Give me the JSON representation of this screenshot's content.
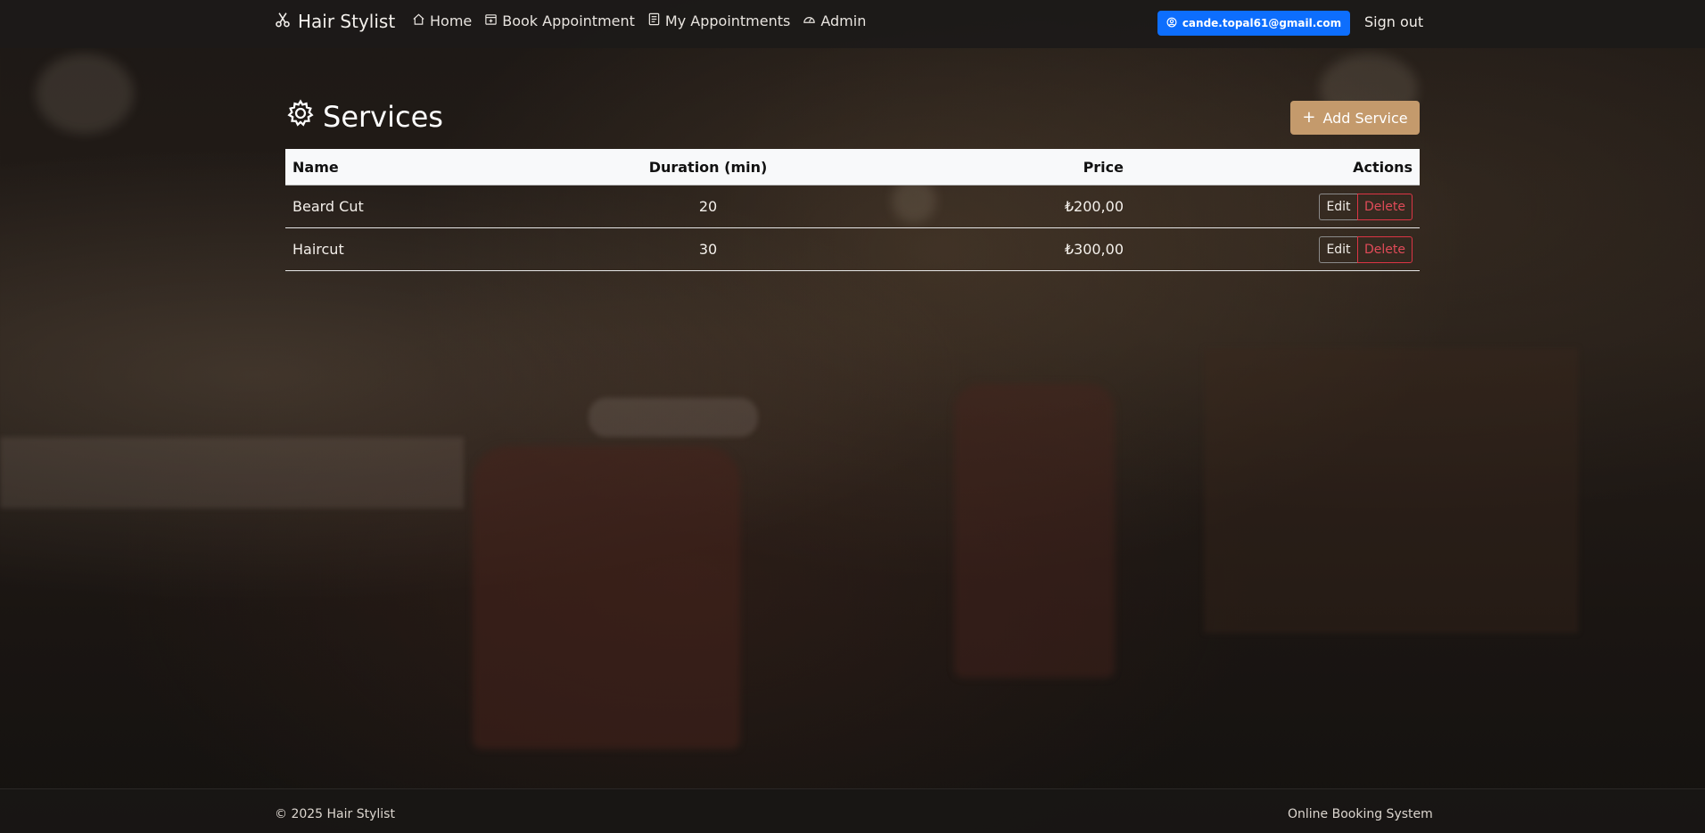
{
  "nav": {
    "brand": "Hair Stylist",
    "links": [
      {
        "label": "Home",
        "icon": "home-icon"
      },
      {
        "label": "Book Appointment",
        "icon": "calendar-plus-icon"
      },
      {
        "label": "My Appointments",
        "icon": "list-icon"
      },
      {
        "label": "Admin",
        "icon": "speedometer-icon"
      }
    ],
    "user_email": "cande.topal61@gmail.com",
    "signout": "Sign out"
  },
  "main": {
    "title": "Services",
    "add_button": "Add Service",
    "table": {
      "headers": [
        "Name",
        "Duration (min)",
        "Price",
        "Actions"
      ],
      "rows": [
        {
          "name": "Beard Cut",
          "duration": "20",
          "price": "₺200,00",
          "edit": "Edit",
          "delete": "Delete"
        },
        {
          "name": "Haircut",
          "duration": "30",
          "price": "₺300,00",
          "edit": "Edit",
          "delete": "Delete"
        }
      ]
    }
  },
  "footer": {
    "left": "© 2025 Hair Stylist",
    "right": "Online Booking System"
  },
  "colors": {
    "primary": "#0d6efd",
    "accent": "#c49a6c",
    "danger": "#dc3545"
  }
}
